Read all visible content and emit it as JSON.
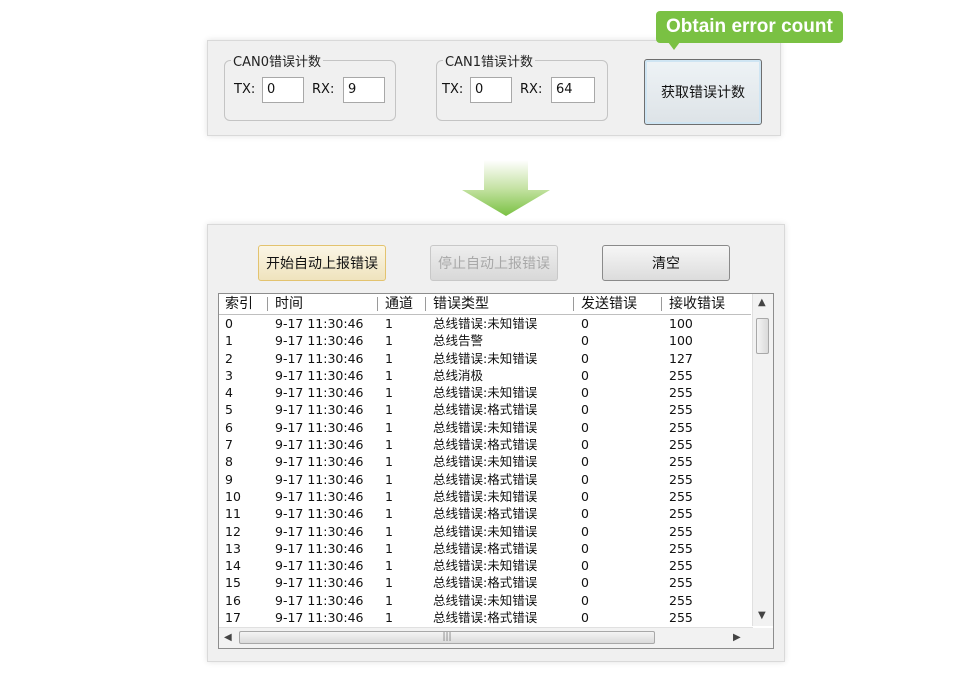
{
  "callout": {
    "text": "Obtain error count"
  },
  "can0": {
    "title": "CAN0错误计数",
    "tx_label": "TX:",
    "tx_value": "0",
    "rx_label": "RX:",
    "rx_value": "9"
  },
  "can1": {
    "title": "CAN1错误计数",
    "tx_label": "TX:",
    "tx_value": "0",
    "rx_label": "RX:",
    "rx_value": "64"
  },
  "obtain_button": "获取错误计数",
  "toolbar": {
    "start_label": "开始自动上报错误",
    "stop_label": "停止自动上报错误",
    "clear_label": "清空"
  },
  "table": {
    "columns": [
      "索引",
      "时间",
      "通道",
      "错误类型",
      "发送错误",
      "接收错误"
    ],
    "rows": [
      [
        "0",
        "9-17 11:30:46",
        "1",
        "总线错误:未知错误",
        "0",
        "100"
      ],
      [
        "1",
        "9-17 11:30:46",
        "1",
        "总线告警",
        "0",
        "100"
      ],
      [
        "2",
        "9-17 11:30:46",
        "1",
        "总线错误:未知错误",
        "0",
        "127"
      ],
      [
        "3",
        "9-17 11:30:46",
        "1",
        "总线消极",
        "0",
        "255"
      ],
      [
        "4",
        "9-17 11:30:46",
        "1",
        "总线错误:未知错误",
        "0",
        "255"
      ],
      [
        "5",
        "9-17 11:30:46",
        "1",
        "总线错误:格式错误",
        "0",
        "255"
      ],
      [
        "6",
        "9-17 11:30:46",
        "1",
        "总线错误:未知错误",
        "0",
        "255"
      ],
      [
        "7",
        "9-17 11:30:46",
        "1",
        "总线错误:格式错误",
        "0",
        "255"
      ],
      [
        "8",
        "9-17 11:30:46",
        "1",
        "总线错误:未知错误",
        "0",
        "255"
      ],
      [
        "9",
        "9-17 11:30:46",
        "1",
        "总线错误:格式错误",
        "0",
        "255"
      ],
      [
        "10",
        "9-17 11:30:46",
        "1",
        "总线错误:未知错误",
        "0",
        "255"
      ],
      [
        "11",
        "9-17 11:30:46",
        "1",
        "总线错误:格式错误",
        "0",
        "255"
      ],
      [
        "12",
        "9-17 11:30:46",
        "1",
        "总线错误:未知错误",
        "0",
        "255"
      ],
      [
        "13",
        "9-17 11:30:46",
        "1",
        "总线错误:格式错误",
        "0",
        "255"
      ],
      [
        "14",
        "9-17 11:30:46",
        "1",
        "总线错误:未知错误",
        "0",
        "255"
      ],
      [
        "15",
        "9-17 11:30:46",
        "1",
        "总线错误:格式错误",
        "0",
        "255"
      ],
      [
        "16",
        "9-17 11:30:46",
        "1",
        "总线错误:未知错误",
        "0",
        "255"
      ],
      [
        "17",
        "9-17 11:30:46",
        "1",
        "总线错误:格式错误",
        "0",
        "255"
      ]
    ]
  },
  "scroll_glyphs": {
    "up": "▲",
    "down": "▼",
    "left": "◀",
    "right": "▶",
    "grip": "|||"
  },
  "colors": {
    "callout_green": "#7ac143"
  }
}
